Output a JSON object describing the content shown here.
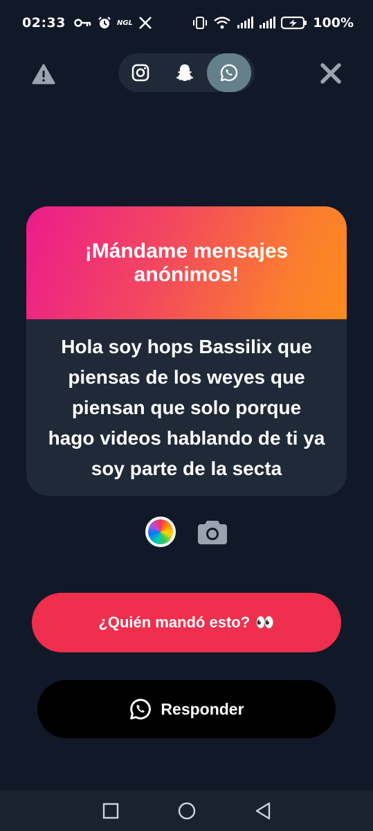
{
  "status_bar": {
    "time": "02:33",
    "ngl_label": "NGL",
    "battery": "100%",
    "icons": [
      "key-icon",
      "alarm-icon",
      "ngl-icon",
      "x-icon",
      "vibrate-icon",
      "wifi-icon",
      "signal-icon",
      "signal-icon",
      "battery-icon"
    ]
  },
  "top_bar": {
    "warning_icon": "warning-icon",
    "share_targets": [
      {
        "name": "instagram",
        "icon": "instagram-icon",
        "active": false
      },
      {
        "name": "snapchat",
        "icon": "snapchat-icon",
        "active": false
      },
      {
        "name": "whatsapp",
        "icon": "whatsapp-icon",
        "active": true
      }
    ],
    "close_icon": "close-icon"
  },
  "card": {
    "title": "¡Mándame mensajes anónimos!",
    "message": "Hola soy hops Bassilix que piensas de los weyes que piensan que solo porque hago videos hablando de ti ya soy parte de la secta"
  },
  "tools": {
    "color_icon": "color-wheel-icon",
    "camera_icon": "camera-icon"
  },
  "buttons": {
    "who_sent": "¿Quién mandó esto?",
    "who_sent_emoji": "👀",
    "reply": "Responder"
  },
  "colors": {
    "background": "#111827",
    "card_body": "#1f2937",
    "gradient_start": "#ec1b8c",
    "gradient_end": "#fd8a1c",
    "who_button": "#ef2f4d",
    "reply_button": "#000000",
    "active_share": "#64808a"
  }
}
